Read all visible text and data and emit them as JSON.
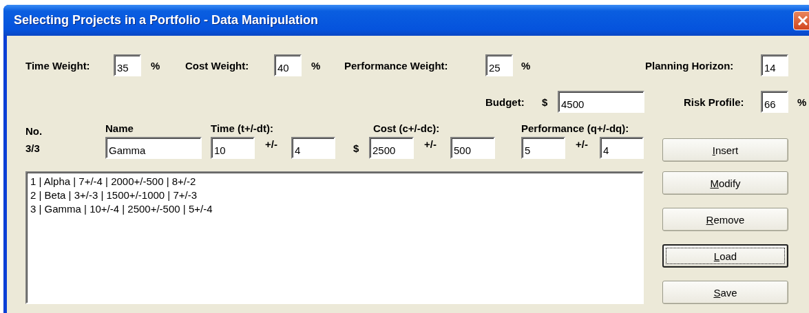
{
  "window": {
    "title": "Selecting Projects in a Portfolio - Data Manipulation"
  },
  "weights": [
    {
      "label": "Time Weight:",
      "value": "35",
      "unit": "%"
    },
    {
      "label": "Cost Weight:",
      "value": "40",
      "unit": "%"
    },
    {
      "label": "Performance Weight:",
      "value": "25",
      "unit": "%"
    }
  ],
  "planning_horizon": {
    "label": "Planning Horizon:",
    "value": "14"
  },
  "budget": {
    "label": "Budget:",
    "currency": "$",
    "value": "4500"
  },
  "risk_profile": {
    "label": "Risk Profile:",
    "value": "66",
    "unit": "%"
  },
  "editor": {
    "no_label": "No.",
    "counter": "3/3",
    "name_label": "Name",
    "name_value": "Gamma",
    "groups": [
      {
        "label": "Time (t+/-dt):",
        "value": "10",
        "sep": "+/-",
        "delta": "4"
      },
      {
        "label": "Cost (c+/-dc):",
        "prefix": "$",
        "value": "2500",
        "sep": "+/-",
        "delta": "500"
      },
      {
        "label": "Performance (q+/-dq):",
        "value": "5",
        "sep": "+/-",
        "delta": "4"
      }
    ]
  },
  "list": {
    "items": [
      "1 | Alpha | 7+/-4 | 2000+/-500 | 8+/-2",
      "2 | Beta | 3+/-3 | 1500+/-1000 | 7+/-3",
      "3 | Gamma | 10+/-4 | 2500+/-500 | 5+/-4"
    ]
  },
  "buttons": [
    {
      "label": "Insert",
      "focused": false,
      "mnemonic": true
    },
    {
      "label": "Modify",
      "focused": false,
      "mnemonic": true
    },
    {
      "label": "Remove",
      "focused": false,
      "mnemonic": true
    },
    {
      "label": "Load",
      "focused": true,
      "mnemonic": true
    },
    {
      "label": "Save",
      "focused": false,
      "mnemonic": true
    }
  ]
}
